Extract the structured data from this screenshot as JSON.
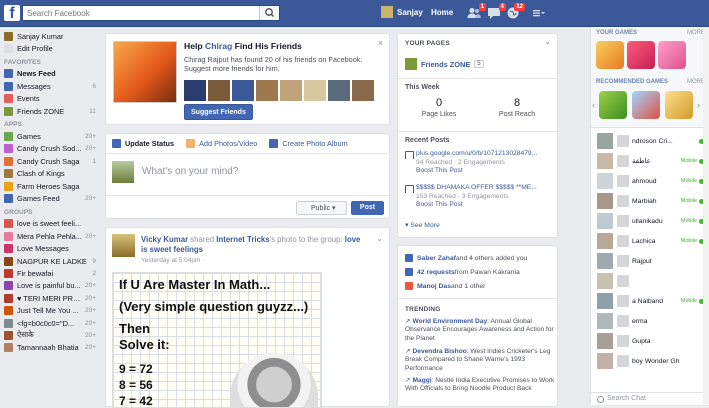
{
  "topbar": {
    "search_placeholder": "Search Facebook",
    "user": "Sanjay",
    "home": "Home",
    "badges": {
      "friends": "1",
      "messages": "4",
      "notifications": "12"
    }
  },
  "leftnav": {
    "profile": [
      {
        "label": "Sanjay Kumar",
        "color": "#8b6d2a"
      },
      {
        "label": "Edit Profile",
        "color": "#dddfe2"
      }
    ],
    "favorites_header": "FAVORITES",
    "favorites": [
      {
        "label": "News Feed",
        "count": "",
        "color": "#4267b2",
        "bold": true
      },
      {
        "label": "Messages",
        "count": "6",
        "color": "#4267b2"
      },
      {
        "label": "Events",
        "count": "",
        "color": "#e35d5b"
      },
      {
        "label": "Friends ZONE",
        "count": "11",
        "color": "#7b9a3a"
      }
    ],
    "apps_header": "APPS",
    "apps": [
      {
        "label": "Games",
        "count": "20+",
        "color": "#6aa84f"
      },
      {
        "label": "Candy Crush Sod...",
        "count": "20+",
        "color": "#c05fd1"
      },
      {
        "label": "Candy Crush Saga",
        "count": "1",
        "color": "#e66e2e"
      },
      {
        "label": "Clash of Kings",
        "count": "",
        "color": "#9c7a3c"
      },
      {
        "label": "Farm Heroes Saga",
        "count": "",
        "color": "#e8a317"
      },
      {
        "label": "Games Feed",
        "count": "20+",
        "color": "#4267b2"
      }
    ],
    "groups_header": "GROUPS",
    "groups": [
      {
        "label": "love is sweet feeli...",
        "count": "",
        "color": "#d9534f"
      },
      {
        "label": "Mera Pehla Pehla...",
        "count": "20+",
        "color": "#e87aa0"
      },
      {
        "label": "Love Messages",
        "count": "",
        "color": "#cc3366"
      },
      {
        "label": "NAGPUR KE LADKE",
        "count": "9",
        "color": "#8b4513"
      },
      {
        "label": "Fir bewafai",
        "count": "2",
        "color": "#c0392b"
      },
      {
        "label": "Love is painful bu...",
        "count": "20+",
        "color": "#8e44ad"
      },
      {
        "label": "♥ TERI MERI PRE...",
        "count": "20+",
        "color": "#b03a2e"
      },
      {
        "label": "Just Tell Me You ...",
        "count": "20+",
        "color": "#d35400"
      },
      {
        "label": "<fg=b0c0c0=\"D...",
        "count": "20+",
        "color": "#7f8c8d"
      },
      {
        "label": "ऐसाके",
        "count": "20+",
        "color": "#a0522d"
      },
      {
        "label": "Tamannaah Bhatia",
        "count": "20+",
        "color": "#b08060"
      }
    ]
  },
  "friends_card": {
    "title_pre": "Help ",
    "title_name": "Chirag",
    "title_post": " Find His Friends",
    "desc": "Chirag Rajput has found 20 of his friends on Facebook. Suggest more friends for him.",
    "button": "Suggest Friends",
    "close": "×"
  },
  "composer": {
    "tab1": "Update Status",
    "tab2": "Add Photos/Video",
    "tab3": "Create Photo Album",
    "placeholder": "What's on your mind?",
    "privacy": "Public ▾",
    "post": "Post"
  },
  "story": {
    "actor": "Vicky Kumar",
    "mid1": " shared ",
    "src": "Internet Tricks",
    "mid2": "'s photo to the group: ",
    "group": "love is sweet feelings",
    "time": "Yesterday at 5:04pm · ",
    "meme": {
      "l1": "If U Are Master In Math...",
      "l2": "(Very simple question guyzz...)",
      "l3": "Then",
      "l4": "Solve it:",
      "l5": "9 = 72",
      "l6": "8 = 56",
      "l7": "7 = 42"
    }
  },
  "pages": {
    "header": "YOUR PAGES",
    "page_name": "Friends ZONE",
    "page_count": "5",
    "this_week": "This Week",
    "likes_val": "0",
    "likes_lbl": "Page Likes",
    "reach_val": "8",
    "reach_lbl": "Post Reach",
    "recent": "Recent Posts",
    "posts": [
      {
        "title": "plus.google.com/u/0/b/1071213028479...",
        "stats": "94 Reached · 2 Engagements",
        "boost": "Boost This Post"
      },
      {
        "title": "$$$$$ DHAMAKA OFFER $$$$$ **ME...",
        "stats": "153 Reached · 3 Engagements",
        "boost": "Boost This Post"
      }
    ],
    "see_more": "▾  See More"
  },
  "notifs": {
    "row1_name": "Saber Zahaf",
    "row1_rest": " and 4 others added you",
    "row2_name": "42 requests",
    "row2_rest": " from Pawan Kakrania",
    "row3_name": "Manoj Das",
    "row3_rest": " and 1 other",
    "trending": "TRENDING",
    "trends": [
      {
        "name": "World Environment Day",
        "text": ": Annual Global Observance Encourages Awareness and Action for the Planet"
      },
      {
        "name": "Devendra Bishoo",
        "text": ": West Indies Cricketer's Leg Break Compared to Shane Warne's 1993 Performance"
      },
      {
        "name": "Maggi",
        "text": ": Nestlé India Executive Promises to Work With Officials to Bring Noodle Product Back"
      }
    ]
  },
  "games": {
    "your": "YOUR GAMES",
    "more": "MORE",
    "recommended": "RECOMMENDED GAMES",
    "more2": "MORE"
  },
  "chat": {
    "rows": [
      {
        "name": "ndroson Cri...",
        "mobile": "",
        "online": true
      },
      {
        "name": "عاطفة",
        "mobile": "Mobile",
        "online": true
      },
      {
        "name": "ahmoud",
        "mobile": "Mobile",
        "online": true
      },
      {
        "name": "Marbiah",
        "mobile": "Mobile",
        "online": true
      },
      {
        "name": "ullanikadu",
        "mobile": "Mobile",
        "online": true
      },
      {
        "name": "Lachica",
        "mobile": "Mobile",
        "online": true
      },
      {
        "name": "Rajput",
        "mobile": "",
        "online": false
      },
      {
        "name": "",
        "mobile": "",
        "online": false
      },
      {
        "name": "a Nalband",
        "mobile": "Mobile",
        "online": true
      },
      {
        "name": "erma",
        "mobile": "",
        "online": false
      },
      {
        "name": "Gupta",
        "mobile": "",
        "online": false
      },
      {
        "name": "boy Wonder Gh",
        "mobile": "",
        "online": false
      }
    ],
    "search": "Search Chat"
  }
}
